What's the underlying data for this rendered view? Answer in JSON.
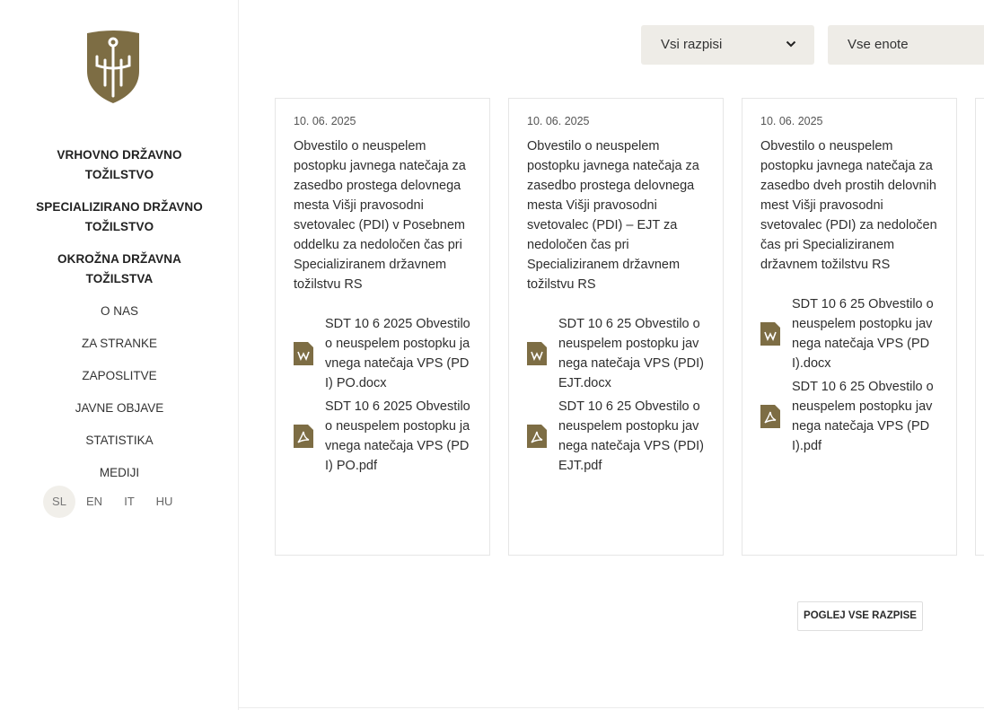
{
  "sidebar": {
    "logo_icon": "trident-shield-logo",
    "brand_color": "#7d6d44",
    "primary_nav": [
      "VRHOVNO DRŽAVNO TOŽILSTVO",
      "SPECIALIZIRANO DRŽAVNO TOŽILSTVO",
      "OKROŽNA DRŽAVNA TOŽILSTVA"
    ],
    "secondary_nav": [
      "O NAS",
      "ZA STRANKE",
      "ZAPOSLITVE",
      "JAVNE OBJAVE",
      "STATISTIKA",
      "MEDIJI"
    ],
    "languages": [
      {
        "label": "SL",
        "active": true
      },
      {
        "label": "EN",
        "active": false
      },
      {
        "label": "IT",
        "active": false
      },
      {
        "label": "HU",
        "active": false
      }
    ]
  },
  "filters": {
    "tenders_select": "Vsi razpisi",
    "units_select": "Vse enote"
  },
  "cards": [
    {
      "date": "10. 06. 2025",
      "title": "Obvestilo o neuspelem postopku javnega natečaja za zasedbo prostega delovnega mesta Višji pravosodni svetovalec (PDI) v Posebnem oddelku za nedoločen čas pri Specializiranem državnem tožilstvu RS",
      "files": [
        {
          "icon": "word-file-icon",
          "name": "SDT 10 6 2025 Obvestilo o neuspelem postopku javnega natečaja VPS (PDI) PO.docx"
        },
        {
          "icon": "pdf-file-icon",
          "name": "SDT 10 6 2025 Obvestilo o neuspelem postopku javnega natečaja VPS (PDI) PO.pdf"
        }
      ]
    },
    {
      "date": "10. 06. 2025",
      "title": "Obvestilo o neuspelem postopku javnega natečaja za zasedbo prostega delovnega mesta Višji pravosodni svetovalec (PDI) – EJT za nedoločen čas pri Specializiranem državnem tožilstvu RS",
      "files": [
        {
          "icon": "word-file-icon",
          "name": "SDT 10 6 25 Obvestilo o neuspelem postopku javnega natečaja VPS (PDI) EJT.docx"
        },
        {
          "icon": "pdf-file-icon",
          "name": "SDT 10 6 25 Obvestilo o neuspelem postopku javnega natečaja VPS (PDI) EJT.pdf"
        }
      ]
    },
    {
      "date": "10. 06. 2025",
      "title": "Obvestilo o neuspelem postopku javnega natečaja za zasedbo dveh prostih delovnih mest Višji pravosodni svetovalec (PDI) za nedoločen čas pri Specializiranem državnem tožilstvu RS",
      "files": [
        {
          "icon": "word-file-icon",
          "name": "SDT 10 6 25 Obvestilo o neuspelem postopku javnega natečaja VPS (PDI).docx"
        },
        {
          "icon": "pdf-file-icon",
          "name": "SDT 10 6 25 Obvestilo o neuspelem postopku javnega natečaja VPS (PDI).pdf"
        }
      ]
    }
  ],
  "more_button": "POGLEJ VSE RAZPISE"
}
